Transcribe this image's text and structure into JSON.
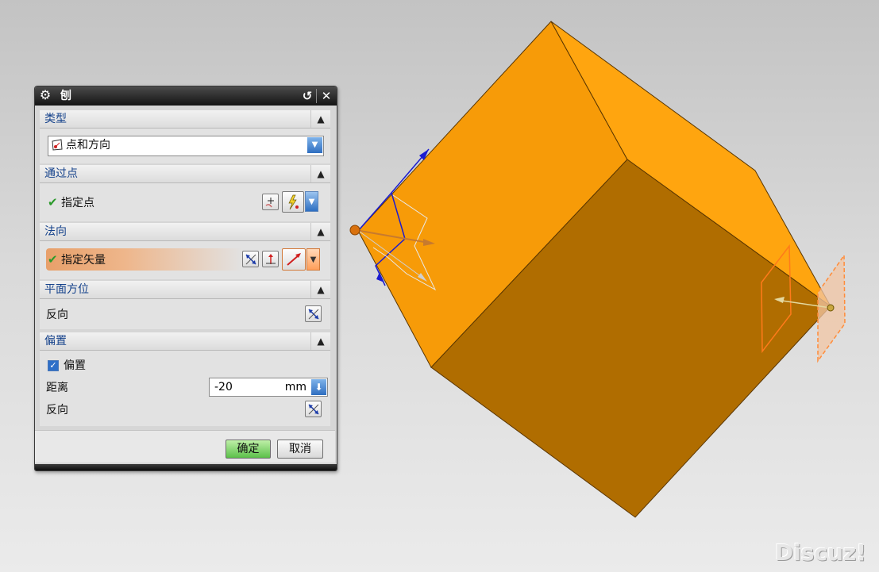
{
  "dialog": {
    "title": "刨",
    "sections": {
      "type": {
        "label": "类型",
        "value": "点和方向"
      },
      "through_point": {
        "label": "通过点",
        "item": "指定点"
      },
      "normal": {
        "label": "法向",
        "item": "指定矢量"
      },
      "orientation": {
        "label": "平面方位",
        "reverse": "反向"
      },
      "offset": {
        "label": "偏置",
        "checkbox_label": "偏置",
        "checkbox_checked": true,
        "distance_label": "距离",
        "distance_value": "-20",
        "distance_unit": "mm",
        "reverse": "反向"
      }
    },
    "buttons": {
      "ok": "确定",
      "cancel": "取消"
    }
  },
  "watermark": "Discuz!",
  "colors": {
    "cube_top": "#f79b08",
    "cube_right": "#ffa50f",
    "cube_front": "#b06d00",
    "accent_blue": "#15428b",
    "ok_green": "#5cc04a"
  }
}
